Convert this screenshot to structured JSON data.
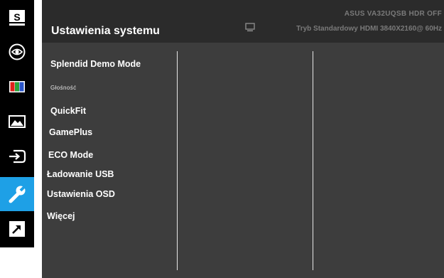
{
  "sidebar": {
    "items": [
      {
        "icon": "splendid-s-icon",
        "label": "S"
      },
      {
        "icon": "eye-icon"
      },
      {
        "icon": "color-bars-icon"
      },
      {
        "icon": "image-icon"
      },
      {
        "icon": "input-select-icon"
      },
      {
        "icon": "wrench-icon",
        "active": true
      },
      {
        "icon": "shortcut-arrow-icon"
      }
    ]
  },
  "header": {
    "title": "Ustawienia systemu",
    "model": "ASUS  VA32UQSB  HDR OFF",
    "status": "Tryb Standardowy HDMI 3840X2160@ 60Hz"
  },
  "menu": {
    "items": [
      {
        "label": "Splendid Demo Mode"
      },
      {
        "label": "Głośność"
      },
      {
        "label": "QuickFit"
      },
      {
        "label": "GamePlus"
      },
      {
        "label": "ECO Mode"
      },
      {
        "label": "Ładowanie USB"
      },
      {
        "label": "Ustawienia OSD"
      },
      {
        "label": "Więcej"
      }
    ]
  },
  "colors": {
    "sidebar_bg": "#000000",
    "active_accent": "#1ea0e6",
    "panel_bg": "#3d3d3d",
    "header_bg": "#2b2b2b",
    "header_text_dim": "#7a7a7a"
  }
}
